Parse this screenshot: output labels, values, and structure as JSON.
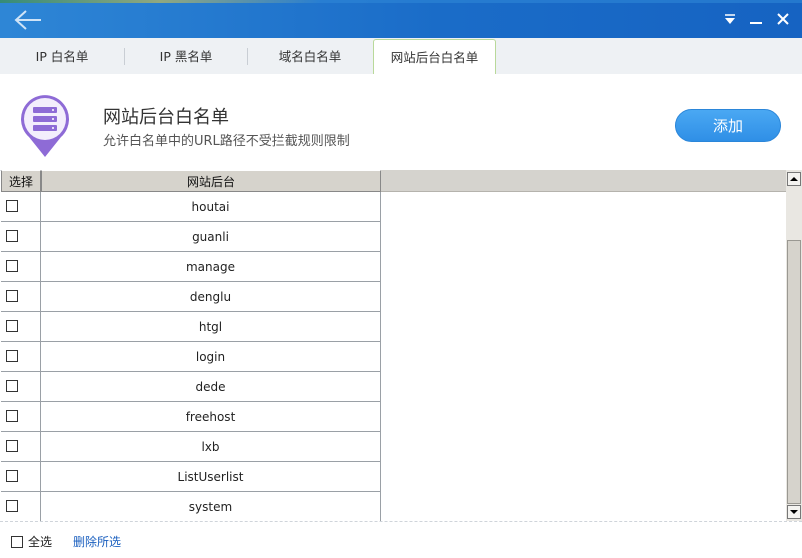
{
  "colors": {
    "titlebar": "#1a6cc8",
    "accent": "#2f8fe6",
    "active_tab_border": "#b9d99a",
    "link": "#1a5fbf",
    "logo": "#8e6bd6"
  },
  "window": {
    "back_icon": "arrow-left-icon",
    "menu_icon": "dropdown-triangle-icon",
    "minimize_icon": "minimize-icon",
    "close_icon": "close-icon"
  },
  "tabs": [
    {
      "label": "IP 白名单",
      "active": false
    },
    {
      "label": "IP 黑名单",
      "active": false
    },
    {
      "label": "域名白名单",
      "active": false
    },
    {
      "label": "网站后台白名单",
      "active": true
    }
  ],
  "header": {
    "icon": "server-pin-icon",
    "title": "网站后台白名单",
    "subtitle": "允许白名单中的URL路径不受拦截规则限制",
    "add_label": "添加"
  },
  "table": {
    "columns": [
      "选择",
      "网站后台"
    ],
    "rows": [
      {
        "checked": false,
        "name": "houtai"
      },
      {
        "checked": false,
        "name": "guanli"
      },
      {
        "checked": false,
        "name": "manage"
      },
      {
        "checked": false,
        "name": "denglu"
      },
      {
        "checked": false,
        "name": "htgl"
      },
      {
        "checked": false,
        "name": "login"
      },
      {
        "checked": false,
        "name": "dede"
      },
      {
        "checked": false,
        "name": "freehost"
      },
      {
        "checked": false,
        "name": "lxb"
      },
      {
        "checked": false,
        "name": "ListUserlist"
      },
      {
        "checked": false,
        "name": "system"
      }
    ]
  },
  "footer": {
    "select_all_label": "全选",
    "delete_selected_label": "删除所选"
  }
}
